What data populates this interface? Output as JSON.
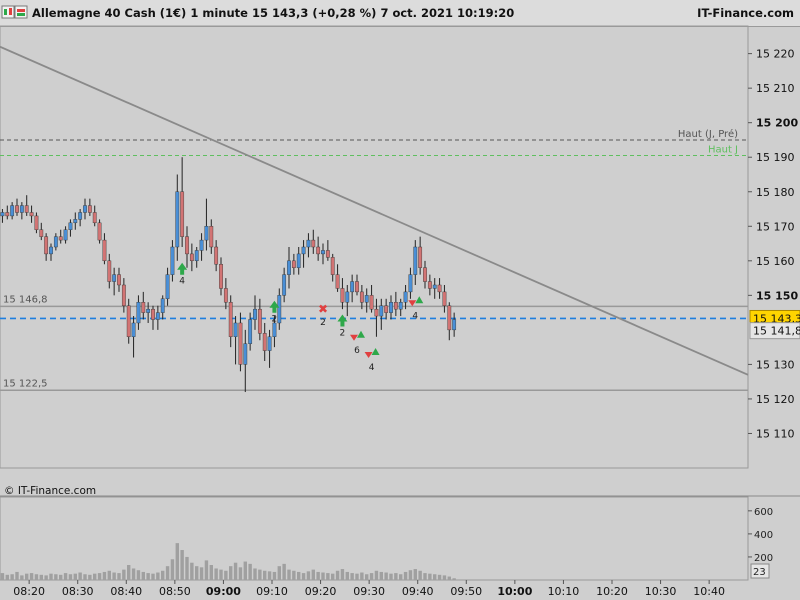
{
  "header": {
    "instrument": "Allemagne 40 Cash (1€)",
    "timeframe": "1 minute",
    "last_price": "15 143,3",
    "change": "(+0,28 %)",
    "datetime": "7 oct. 2021 10:19:20",
    "brand": "IT-Finance.com",
    "icons": [
      "candlestick-chart-icon",
      "color-scheme-icon"
    ]
  },
  "watermark": "© IT-Finance.com",
  "colors": {
    "background": "#cfcfcf",
    "bullish": "#4a8fd6",
    "bearish": "#d27474",
    "wick": "#222222",
    "trendline": "#8a8a8a",
    "last_price_line": "#1e7fe0",
    "haut_j": "#5fbf5f",
    "haut_j_pre": "#555555",
    "volume": "#a0a0a0",
    "signal_up": "#2ea84a",
    "signal_down": "#e04040"
  },
  "chart_data": {
    "type": "candlestick",
    "title": "Allemagne 40 Cash (1€) 1 minute",
    "x_ticks": [
      {
        "label": "08:20",
        "bold": false
      },
      {
        "label": "08:30",
        "bold": false
      },
      {
        "label": "08:40",
        "bold": false
      },
      {
        "label": "08:50",
        "bold": false
      },
      {
        "label": "09:00",
        "bold": true
      },
      {
        "label": "09:10",
        "bold": false
      },
      {
        "label": "09:20",
        "bold": false
      },
      {
        "label": "09:30",
        "bold": false
      },
      {
        "label": "09:40",
        "bold": false
      },
      {
        "label": "09:50",
        "bold": false
      },
      {
        "label": "10:00",
        "bold": true
      },
      {
        "label": "10:10",
        "bold": false
      },
      {
        "label": "10:20",
        "bold": false
      },
      {
        "label": "10:30",
        "bold": false
      },
      {
        "label": "10:40",
        "bold": false
      }
    ],
    "y_ticks": [
      {
        "value": 15220,
        "label": "15 220",
        "bold": false
      },
      {
        "value": 15210,
        "label": "15 210",
        "bold": false
      },
      {
        "value": 15200,
        "label": "15 200",
        "bold": true
      },
      {
        "value": 15190,
        "label": "15 190",
        "bold": false
      },
      {
        "value": 15180,
        "label": "15 180",
        "bold": false
      },
      {
        "value": 15170,
        "label": "15 170",
        "bold": false
      },
      {
        "value": 15160,
        "label": "15 160",
        "bold": false
      },
      {
        "value": 15150,
        "label": "15 150",
        "bold": true
      },
      {
        "value": 15130,
        "label": "15 130",
        "bold": false
      },
      {
        "value": 15120,
        "label": "15 120",
        "bold": false
      },
      {
        "value": 15110,
        "label": "15 110",
        "bold": false
      }
    ],
    "ylim": [
      15100,
      15228
    ],
    "x_range_minutes": [
      "08:14",
      "10:48"
    ],
    "levels": [
      {
        "label": "Haut (J, Pré)",
        "value": 15195,
        "style": "dashed",
        "color": "#555555",
        "label_side": "right"
      },
      {
        "label": "Haut J",
        "value": 15190.5,
        "style": "dashed",
        "color": "#5fbf5f",
        "label_side": "right"
      },
      {
        "label": "15 146,8",
        "value": 15146.8,
        "style": "solid",
        "color": "#999999",
        "label_side": "left"
      },
      {
        "label": "15 122,5",
        "value": 15122.5,
        "style": "solid",
        "color": "#999999",
        "label_side": "left"
      }
    ],
    "last_price": {
      "value": 15143.3,
      "label": "15 143,3"
    },
    "secondary_price": {
      "value": 15141.8,
      "label": "15 141,8"
    },
    "trendline": {
      "start": {
        "time": "08:14",
        "price": 15222
      },
      "end": {
        "time": "10:48",
        "price": 15127
      }
    },
    "candles_ohlc": [
      [
        15173,
        15175,
        15171,
        15174
      ],
      [
        15174,
        15176,
        15172,
        15173
      ],
      [
        15173,
        15177,
        15172,
        15176
      ],
      [
        15176,
        15178,
        15173,
        15174
      ],
      [
        15174,
        15177,
        15172,
        15176
      ],
      [
        15176,
        15179,
        15173,
        15174
      ],
      [
        15174,
        15176,
        15171,
        15173
      ],
      [
        15173,
        15174,
        15168,
        15169
      ],
      [
        15169,
        15171,
        15166,
        15167
      ],
      [
        15167,
        15168,
        15160,
        15162
      ],
      [
        15162,
        15165,
        15160,
        15164
      ],
      [
        15164,
        15168,
        15163,
        15167
      ],
      [
        15167,
        15169,
        15165,
        15166
      ],
      [
        15166,
        15170,
        15165,
        15169
      ],
      [
        15169,
        15172,
        15167,
        15171
      ],
      [
        15171,
        15174,
        15169,
        15172
      ],
      [
        15172,
        15175,
        15170,
        15174
      ],
      [
        15174,
        15178,
        15172,
        15176
      ],
      [
        15176,
        15178,
        15173,
        15174
      ],
      [
        15174,
        15176,
        15170,
        15171
      ],
      [
        15171,
        15172,
        15165,
        15166
      ],
      [
        15166,
        15168,
        15159,
        15160
      ],
      [
        15160,
        15162,
        15152,
        15154
      ],
      [
        15154,
        15158,
        15150,
        15156
      ],
      [
        15156,
        15158,
        15151,
        15153
      ],
      [
        15153,
        15155,
        15145,
        15147
      ],
      [
        15147,
        15149,
        15136,
        15138
      ],
      [
        15138,
        15144,
        15132,
        15142
      ],
      [
        15142,
        15150,
        15140,
        15148
      ],
      [
        15148,
        15151,
        15143,
        15145
      ],
      [
        15145,
        15148,
        15142,
        15146
      ],
      [
        15146,
        15147,
        15140,
        15143
      ],
      [
        15143,
        15147,
        15140,
        15145
      ],
      [
        15145,
        15150,
        15143,
        15149
      ],
      [
        15149,
        15158,
        15147,
        15156
      ],
      [
        15156,
        15166,
        15154,
        15164
      ],
      [
        15164,
        15185,
        15160,
        15180
      ],
      [
        15180,
        15190,
        15164,
        15167
      ],
      [
        15167,
        15170,
        15158,
        15162
      ],
      [
        15162,
        15165,
        15157,
        15160
      ],
      [
        15160,
        15164,
        15158,
        15163
      ],
      [
        15163,
        15168,
        15160,
        15166
      ],
      [
        15166,
        15178,
        15163,
        15170
      ],
      [
        15170,
        15172,
        15162,
        15164
      ],
      [
        15164,
        15166,
        15157,
        15159
      ],
      [
        15159,
        15161,
        15150,
        15152
      ],
      [
        15152,
        15155,
        15146,
        15148
      ],
      [
        15148,
        15150,
        15135,
        15138
      ],
      [
        15138,
        15144,
        15130,
        15142
      ],
      [
        15142,
        15145,
        15128,
        15130
      ],
      [
        15130,
        15140,
        15122,
        15136
      ],
      [
        15136,
        15145,
        15134,
        15143
      ],
      [
        15143,
        15150,
        15140,
        15146
      ],
      [
        15146,
        15149,
        15137,
        15139
      ],
      [
        15139,
        15142,
        15131,
        15134
      ],
      [
        15134,
        15140,
        15129,
        15138
      ],
      [
        15138,
        15144,
        15135,
        15142
      ],
      [
        15142,
        15152,
        15140,
        15150
      ],
      [
        15150,
        15158,
        15148,
        15156
      ],
      [
        15156,
        15164,
        15152,
        15160
      ],
      [
        15160,
        15162,
        15156,
        15158
      ],
      [
        15158,
        15164,
        15156,
        15162
      ],
      [
        15162,
        15166,
        15158,
        15164
      ],
      [
        15164,
        15168,
        15161,
        15166
      ],
      [
        15166,
        15169,
        15162,
        15164
      ],
      [
        15164,
        15167,
        15160,
        15162
      ],
      [
        15162,
        15165,
        15159,
        15163
      ],
      [
        15163,
        15166,
        15160,
        15161
      ],
      [
        15161,
        15162,
        15154,
        15156
      ],
      [
        15156,
        15159,
        15151,
        15152
      ],
      [
        15152,
        15155,
        15146,
        15148
      ],
      [
        15148,
        15153,
        15144,
        15151
      ],
      [
        15151,
        15156,
        15148,
        15154
      ],
      [
        15154,
        15156,
        15150,
        15151
      ],
      [
        15151,
        15153,
        15146,
        15148
      ],
      [
        15148,
        15152,
        15145,
        15150
      ],
      [
        15150,
        15153,
        15145,
        15146
      ],
      [
        15146,
        15149,
        15138,
        15144
      ],
      [
        15144,
        15149,
        15140,
        15147
      ],
      [
        15147,
        15149,
        15143,
        15145
      ],
      [
        15145,
        15150,
        15143,
        15148
      ],
      [
        15148,
        15151,
        15144,
        15146
      ],
      [
        15146,
        15149,
        15144,
        15148
      ],
      [
        15148,
        15153,
        15146,
        15151
      ],
      [
        15151,
        15158,
        15149,
        15156
      ],
      [
        15156,
        15166,
        15153,
        15164
      ],
      [
        15164,
        15167,
        15156,
        15158
      ],
      [
        15158,
        15160,
        15152,
        15154
      ],
      [
        15154,
        15156,
        15150,
        15152
      ],
      [
        15152,
        15155,
        15149,
        15153
      ],
      [
        15153,
        15155,
        15149,
        15151
      ],
      [
        15151,
        15153,
        15145,
        15147
      ],
      [
        15147,
        15148,
        15137,
        15140
      ],
      [
        15140,
        15145,
        15138,
        15143
      ]
    ],
    "volume_axis": {
      "ticks": [
        600,
        400,
        200
      ],
      "ymax": 720
    },
    "volume": [
      60,
      45,
      50,
      70,
      40,
      55,
      60,
      50,
      45,
      40,
      55,
      50,
      45,
      60,
      50,
      55,
      65,
      50,
      45,
      55,
      60,
      70,
      80,
      65,
      60,
      90,
      130,
      100,
      85,
      70,
      60,
      55,
      65,
      80,
      120,
      180,
      320,
      260,
      200,
      150,
      120,
      110,
      170,
      130,
      100,
      90,
      80,
      120,
      150,
      110,
      160,
      140,
      100,
      90,
      80,
      75,
      70,
      120,
      140,
      90,
      80,
      70,
      60,
      75,
      90,
      70,
      65,
      60,
      55,
      80,
      95,
      70,
      60,
      55,
      65,
      50,
      60,
      80,
      70,
      65,
      55,
      60,
      50,
      70,
      85,
      95,
      80,
      60,
      55,
      50,
      45,
      40,
      30,
      15
    ],
    "volume_last_label": "23",
    "signals": [
      {
        "candle": 37,
        "type": "up",
        "count": "4",
        "price": 15158
      },
      {
        "candle": 56,
        "type": "up",
        "count": "2",
        "price": 15147
      },
      {
        "candle": 66,
        "type": "cross",
        "count": "2",
        "price": 15146
      },
      {
        "candle": 70,
        "type": "up",
        "count": "2",
        "price": 15143
      },
      {
        "candle": 73,
        "type": "down-up",
        "count": "6",
        "price": 15138
      },
      {
        "candle": 76,
        "type": "down-up",
        "count": "4",
        "price": 15133
      },
      {
        "candle": 85,
        "type": "down-up",
        "count": "4",
        "price": 15148
      }
    ]
  }
}
